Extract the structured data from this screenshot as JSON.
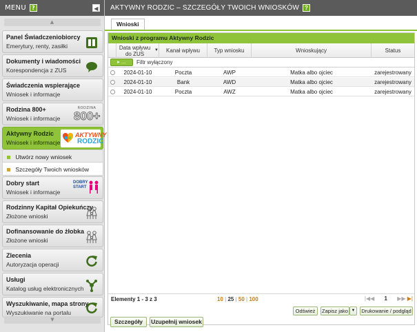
{
  "sidebar": {
    "title": "MENU",
    "help": "?",
    "collapse": "◀",
    "scroll_up": "▲",
    "scroll_down": "▼",
    "items": [
      {
        "title": "Panel Świadczeniobiorcy",
        "subtitle": "Emerytury, renty, zasiłki",
        "icon": "account-panel-icon"
      },
      {
        "title": "Dokumenty i wiadomości",
        "subtitle": "Korespondencja z ZUS",
        "icon": "speech-bubble-icon"
      },
      {
        "title": "Świadczenia wspierające",
        "subtitle": "Wniosek i informacje",
        "icon": ""
      },
      {
        "title": "Rodzina 800+",
        "subtitle": "Wniosek i informacje",
        "icon": "rodzina-800-logo"
      },
      {
        "title": "Aktywny Rodzic",
        "subtitle": "Wniosek i informacje",
        "icon": "aktywny-rodzic-logo"
      },
      {
        "title": "Dobry start",
        "subtitle": "Wniosek i informacje",
        "icon": "dobry-start-logo"
      },
      {
        "title": "Rodzinny Kapitał Opiekuńczy",
        "subtitle": "Złożone wnioski",
        "icon": "family-icon"
      },
      {
        "title": "Dofinansowanie do żłobka",
        "subtitle": "Złożone wnioski",
        "icon": "family-icon"
      },
      {
        "title": "Zlecenia",
        "subtitle": "Autoryzacja operacji",
        "icon": "refresh-icon"
      },
      {
        "title": "Usługi",
        "subtitle": "Katalog usług elektronicznych",
        "icon": "services-icon"
      },
      {
        "title": "Wyszukiwanie, mapa strony",
        "subtitle": "Wyszukiwanie na portalu",
        "icon": "refresh-icon"
      }
    ],
    "subitems": [
      {
        "label": "Utwórz nowy wniosek"
      },
      {
        "label": "Szczegóły Twoich wniosków"
      }
    ],
    "logos": {
      "rodzina_small": "RODZINA",
      "rodzina_big": "800+",
      "aktywny": "AKTYWNY",
      "rodzic": "RODZIC",
      "dobry": "DOBRY",
      "start": "START"
    }
  },
  "header": {
    "title": "AKTYWNY RODZIC – SZCZEGÓŁY TWOICH WNIOSKÓW",
    "help": "?"
  },
  "tabs": [
    {
      "label": "Wnioski"
    }
  ],
  "panel": {
    "title": "Wnioski z programu Aktywny Rodzic",
    "columns": [
      "Data wpływu do ZUS",
      "Kanał wpływu",
      "Typ wniosku",
      "Wnioskujący",
      "Status"
    ],
    "sort_arrow": "▼",
    "filter_button": "▸ ...",
    "filter_label": "Filtr wyłączony",
    "rows": [
      {
        "date": "2024-01-10",
        "channel": "Poczta",
        "type": "AWP",
        "applicant": "Matka albo ojciec",
        "status": "zarejestrowany"
      },
      {
        "date": "2024-01-10",
        "channel": "Bank",
        "type": "AWD",
        "applicant": "Matka albo ojciec",
        "status": "zarejestrowany"
      },
      {
        "date": "2024-01-10",
        "channel": "Poczta",
        "type": "AWZ",
        "applicant": "Matka albo ojciec",
        "status": "zarejestrowany"
      }
    ]
  },
  "pager": {
    "range": "Elementy 1 - 3 z 3",
    "sizes": [
      "10",
      "25",
      "50",
      "100"
    ],
    "sep": "|",
    "page": "1",
    "first": "|◀◀",
    "prev": "◀",
    "next": "▶",
    "last": "▶▶|",
    "last_highlight": "▶|"
  },
  "actions": {
    "refresh": "Odśwież",
    "save_as": "Zapisz jako",
    "dropdown": "▼",
    "print": "Drukowanie / podgląd",
    "details": "Szczegóły",
    "complete": "Uzupełnij wniosek"
  }
}
